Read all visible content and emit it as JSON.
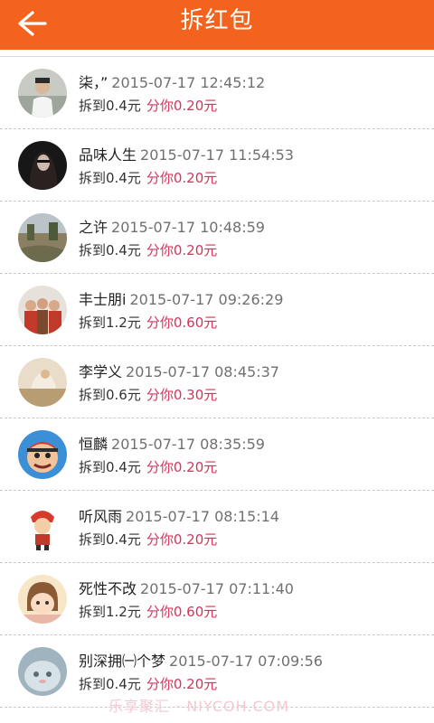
{
  "header": {
    "title": "拆红包",
    "back_icon": "arrow-left-icon",
    "background": "#f4631d"
  },
  "colors": {
    "share_text": "#d6335b",
    "time_text": "#707070"
  },
  "records": [
    {
      "name": "柒，”",
      "time": "2015-07-17 12:45:12",
      "got": "拆到0.4元",
      "share": "分你0.20元"
    },
    {
      "name": "品味人生",
      "time": "2015-07-17 11:54:53",
      "got": "拆到0.4元",
      "share": "分你0.20元"
    },
    {
      "name": "之许",
      "time": "2015-07-17 10:48:59",
      "got": "拆到0.4元",
      "share": "分你0.20元"
    },
    {
      "name": "丰士朋i",
      "time": "2015-07-17 09:26:29",
      "got": "拆到1.2元",
      "share": "分你0.60元"
    },
    {
      "name": "李学义",
      "time": "2015-07-17 08:45:37",
      "got": "拆到0.6元",
      "share": "分你0.30元"
    },
    {
      "name": "恒麟",
      "time": "2015-07-17 08:35:59",
      "got": "拆到0.4元",
      "share": "分你0.20元"
    },
    {
      "name": "听风雨",
      "time": "2015-07-17 08:15:14",
      "got": "拆到0.4元",
      "share": "分你0.20元"
    },
    {
      "name": "死性不改",
      "time": "2015-07-17 07:11:40",
      "got": "拆到1.2元",
      "share": "分你0.60元"
    },
    {
      "name": "别深拥㈠个梦",
      "time": "2015-07-17 07:09:56",
      "got": "拆到0.4元",
      "share": "分你0.20元"
    }
  ],
  "watermark": "乐享聚汇 · NIYCOH.COM"
}
